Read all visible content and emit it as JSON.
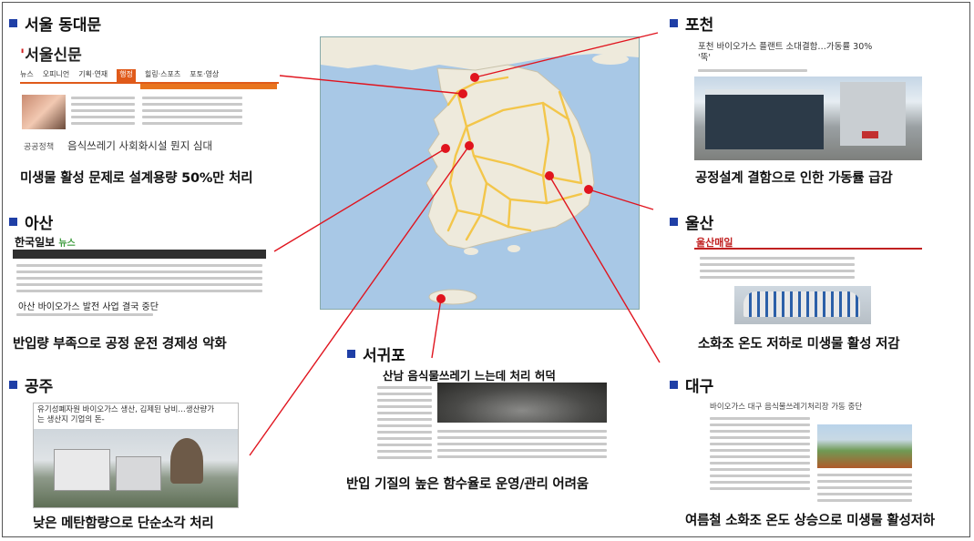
{
  "sections": {
    "seoul": {
      "title": "서울 동대문",
      "logo": "서울신문",
      "nav": [
        "뉴스",
        "오피니언",
        "기획·연재",
        "행정",
        "힐링·스포츠",
        "포토·영상"
      ],
      "headline": "음식쓰레기 사회화시설 뭔지 심대",
      "label": "공공정책",
      "caption": "미생물 활성 문제로 설계용량 50%만 처리"
    },
    "asan": {
      "title": "아산",
      "logo": "한국일보",
      "logo_sub": "뉴스",
      "headline": "아산 바이오가스 발전 사업 결국 중단",
      "caption": "반입량 부족으로 공정 운전 경제성 악화"
    },
    "gongju": {
      "title": "공주",
      "headline_1": "유기성폐자원 바이오가스 생산, 김제된 낭비…생산량가",
      "headline_2": "는 생산지 기업의 돈-",
      "caption": "낮은 메탄함량으로 단순소각 처리"
    },
    "pocheon": {
      "title": "포천",
      "headline_1": "포천 바이오가스 플랜트 소대결함…가동률 30%",
      "headline_2": "'뚝'",
      "caption": "공정설계 결함으로 인한 가동률 급감"
    },
    "ulsan": {
      "title": "울산",
      "logo": "울산매일",
      "caption": "소화조 온도 저하로 미생물 활성 저감"
    },
    "seogwipo": {
      "title": "서귀포",
      "headline": "산남 음식물쓰레기 느는데 처리 허덕",
      "caption": "반입 기질의 높은 함수율로 운영/관리 어려움"
    },
    "daegu": {
      "title": "대구",
      "headline": "바이오가스 대구 음식물쓰레기처리장 가동 중단",
      "caption": "여름철 소화조 온도 상승으로 미생물 활성저하"
    }
  },
  "colors": {
    "bullet": "#1f3fa6",
    "connector": "#e0141e",
    "marker": "#e0141e",
    "sea": "#a8c8e6",
    "land": "#eeeadc",
    "road": "#f3c64a"
  }
}
